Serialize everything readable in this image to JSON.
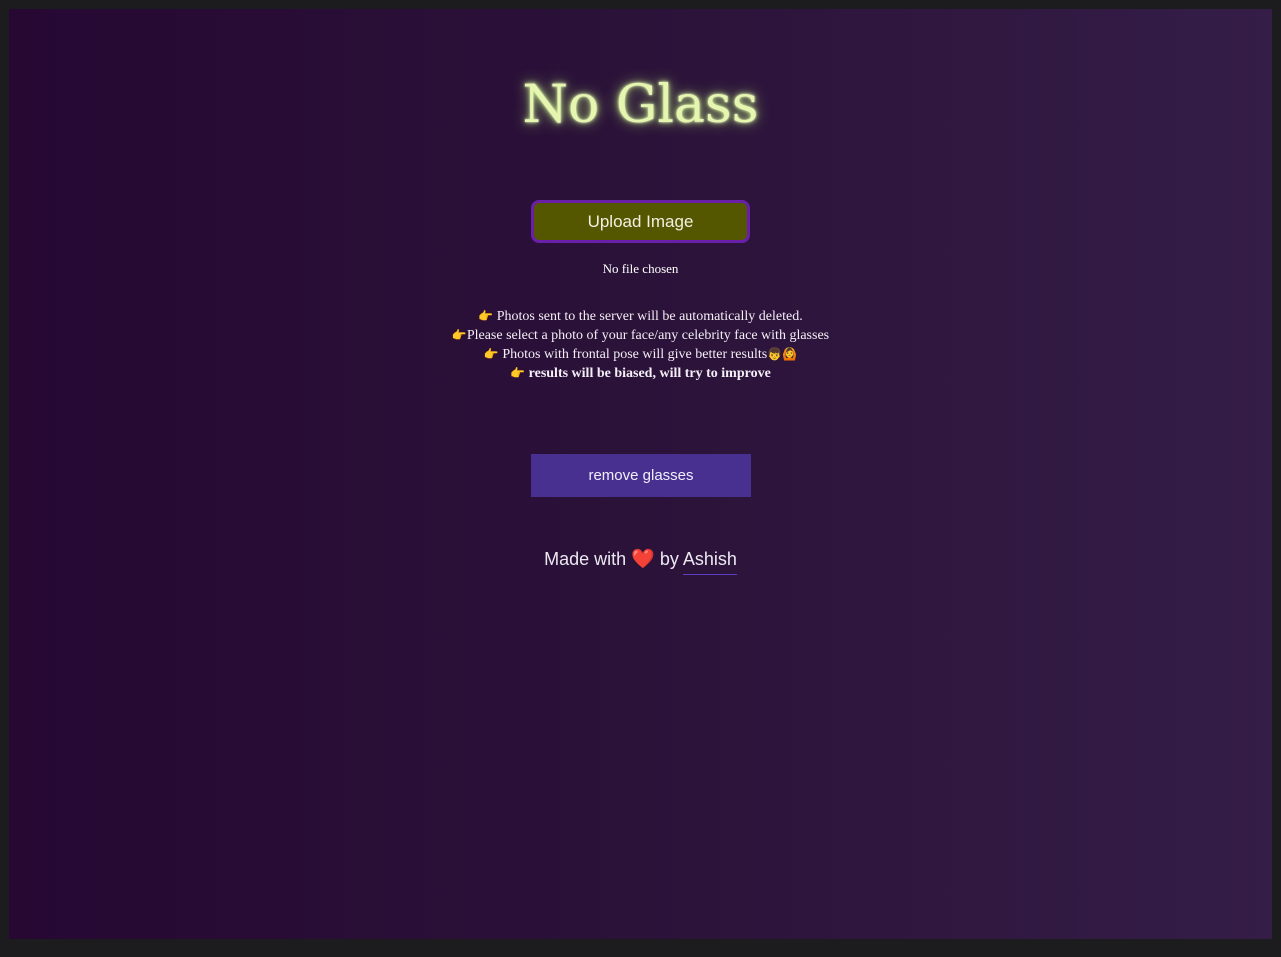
{
  "title": "No Glass",
  "upload": {
    "button_label": "Upload Image",
    "status": "No file chosen"
  },
  "notes": [
    {
      "icon": "pointing-hand-icon",
      "glyph": "👉",
      "text": " Photos sent to the server will be automatically deleted."
    },
    {
      "icon": "pointing-hand-icon",
      "glyph": "👉",
      "text": "Please select a photo of your face/any celebrity face with glasses"
    },
    {
      "icon": "pointing-hand-icon",
      "glyph": "👉",
      "text": " Photos with frontal pose will give better results",
      "extra_glyphs": "👦🙆"
    },
    {
      "icon": "pointing-hand-icon",
      "glyph": "👉",
      "text": " results will be biased, will try to improve"
    }
  ],
  "action": {
    "remove_label": "remove glasses"
  },
  "footer": {
    "made_with": "Made with",
    "heart_glyph": "❤️",
    "by": "by",
    "author": "Ashish"
  },
  "colors": {
    "title_glow": "#e6f5b0",
    "upload_bg": "#555600",
    "upload_border": "#6a1fa8",
    "remove_bg": "#47308f",
    "heart": "#d8232e"
  }
}
